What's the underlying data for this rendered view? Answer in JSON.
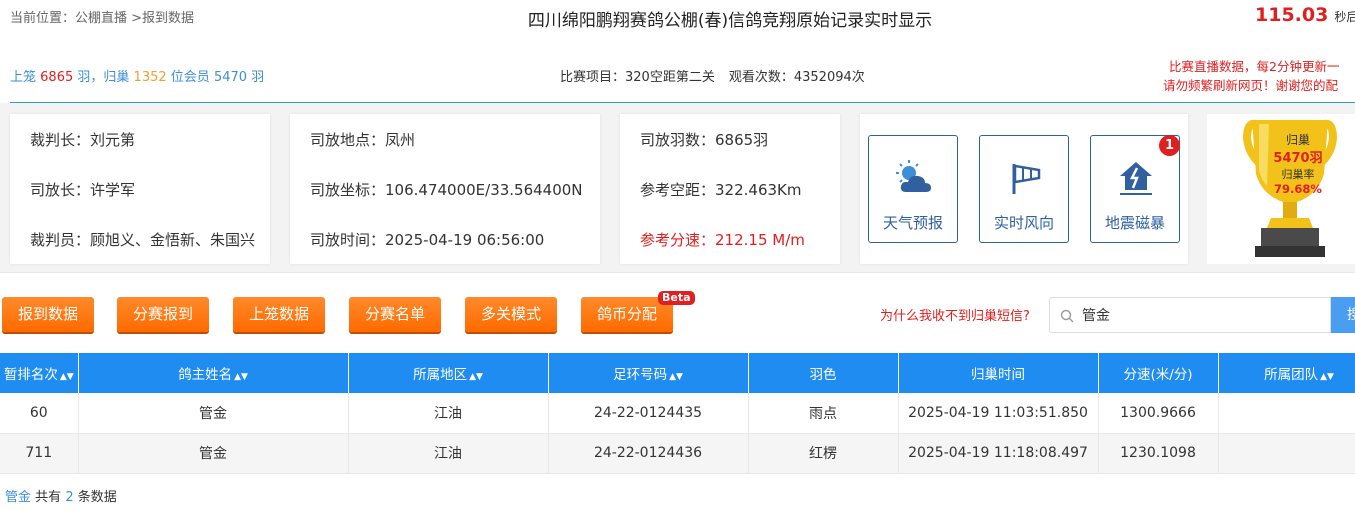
{
  "header": {
    "breadcrumb": "当前位置：公棚直播 >报到数据",
    "title": "四川绵阳鹏翔赛鸽公棚(春)信鸽竞翔原始记录实时显示",
    "timer_value": "115.03",
    "timer_unit": "秒后"
  },
  "stats": {
    "caged_label": "上笼",
    "caged_count": "6865",
    "caged_unit": "羽，归巢",
    "returned_count": "1352",
    "members_label": "位会员",
    "members_count": "5470",
    "members_unit": "羽"
  },
  "race": {
    "item_label": "比赛项目：",
    "item_value": "320空距第二关",
    "views_label": "观看次数：",
    "views_value": "4352094次"
  },
  "notice": {
    "line1": "比赛直播数据，每2分钟更新一",
    "line2": "请勿频繁刷新网页！谢谢您的配"
  },
  "officials": {
    "chief_judge": "裁判长：刘元第",
    "release_chief": "司放长：许学军",
    "judges": "裁判员：顾旭义、金悟新、朱国兴"
  },
  "release": {
    "location": "司放地点：凤州",
    "coordinates": "司放坐标：106.474000E/33.564400N",
    "time": "司放时间：2025-04-19 06:56:00"
  },
  "flight": {
    "birds": "司放羽数：6865羽",
    "distance": "参考空距：322.463Km",
    "speed": "参考分速：212.15 M/m"
  },
  "tools": {
    "weather": "天气预报",
    "wind": "实时风向",
    "quake": "地震磁暴",
    "quake_badge": "1"
  },
  "trophy": {
    "label": "归巢",
    "count": "5470羽",
    "rate_label": "归巢率",
    "rate": "79.68%"
  },
  "buttons": {
    "report": "报到数据",
    "division_report": "分赛报到",
    "caging": "上笼数据",
    "division_list": "分赛名单",
    "multi_stage": "多关模式",
    "coin": "鸽币分配",
    "beta": "Beta"
  },
  "search": {
    "help_link": "为什么我收不到归巢短信?",
    "value": "管金",
    "button_label": "搜"
  },
  "table": {
    "headers": [
      "暂排名次",
      "鸽主姓名",
      "所属地区",
      "足环号码",
      "羽色",
      "归巢时间",
      "分速(米/分)",
      "所属团队"
    ],
    "rows": [
      [
        "60",
        "管金",
        "江油",
        "24-22-0124435",
        "雨点",
        "2025-04-19 11:03:51.850",
        "1300.9666",
        ""
      ],
      [
        "711",
        "管金",
        "江油",
        "24-22-0124436",
        "红楞",
        "2025-04-19 11:18:08.497",
        "1230.1098",
        ""
      ]
    ]
  },
  "footer": {
    "keyword": "管金",
    "prefix": "共有",
    "count": "2",
    "suffix": "条数据"
  },
  "colors": {
    "accent_blue": "#1e8cf0",
    "button_orange": "#ff6a00",
    "alert_red": "#e02020",
    "trophy_gold": "#f2c21a"
  }
}
